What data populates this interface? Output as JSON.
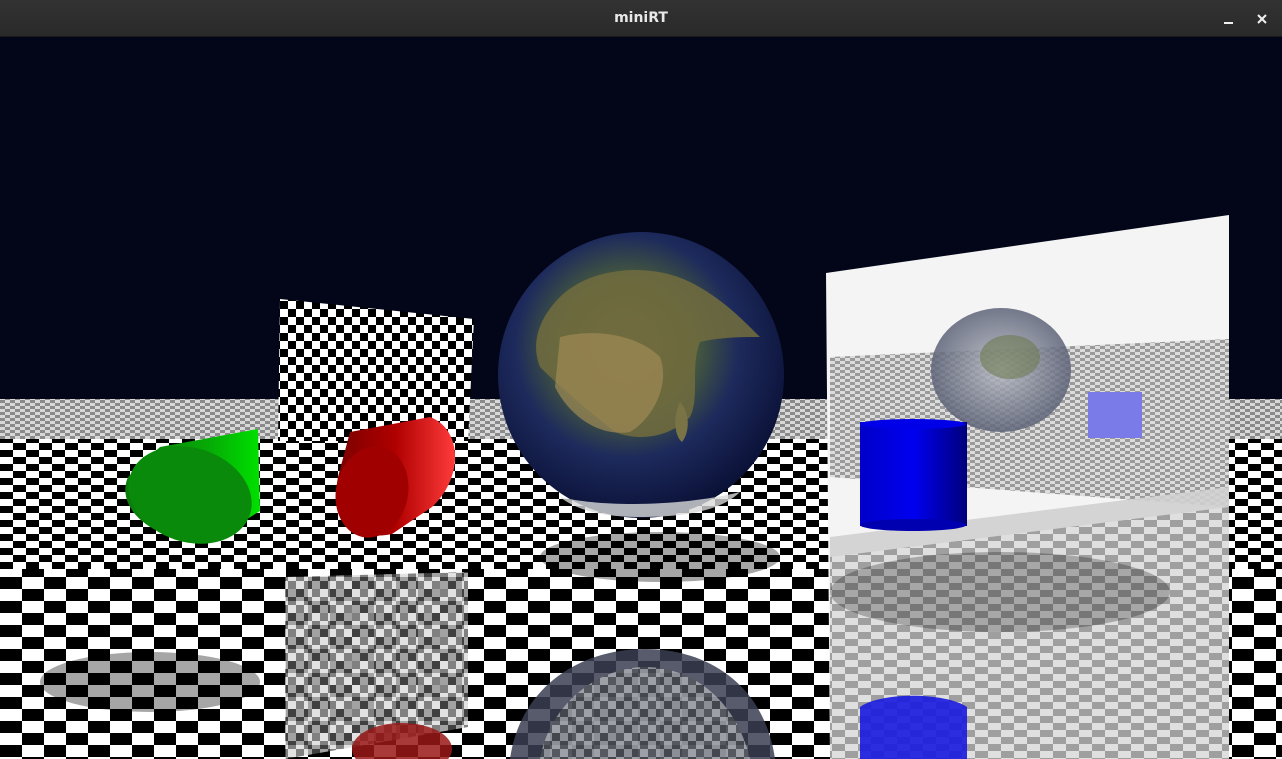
{
  "window": {
    "title": "miniRT",
    "minimize_icon": "minimize-icon",
    "close_icon": "close-icon"
  },
  "scene": {
    "background_color": "#020618",
    "floor_colors": [
      "#ffffff",
      "#000000"
    ],
    "objects": [
      {
        "name": "checkerboard-plane",
        "type": "plane",
        "texture": "checkerboard"
      },
      {
        "name": "earth-sphere",
        "type": "sphere",
        "texture": "earth"
      },
      {
        "name": "green-cylinder",
        "type": "cylinder",
        "color": "#00c000"
      },
      {
        "name": "red-cylinder",
        "type": "cylinder",
        "color": "#c00000"
      },
      {
        "name": "checkered-square",
        "type": "plane",
        "texture": "checkerboard"
      },
      {
        "name": "blue-cylinder",
        "type": "cylinder",
        "color": "#0000e0"
      },
      {
        "name": "blue-cube",
        "type": "cube",
        "color": "#7a7ae8"
      },
      {
        "name": "mirror-plane",
        "type": "plane",
        "color": "#ffffff"
      }
    ]
  }
}
